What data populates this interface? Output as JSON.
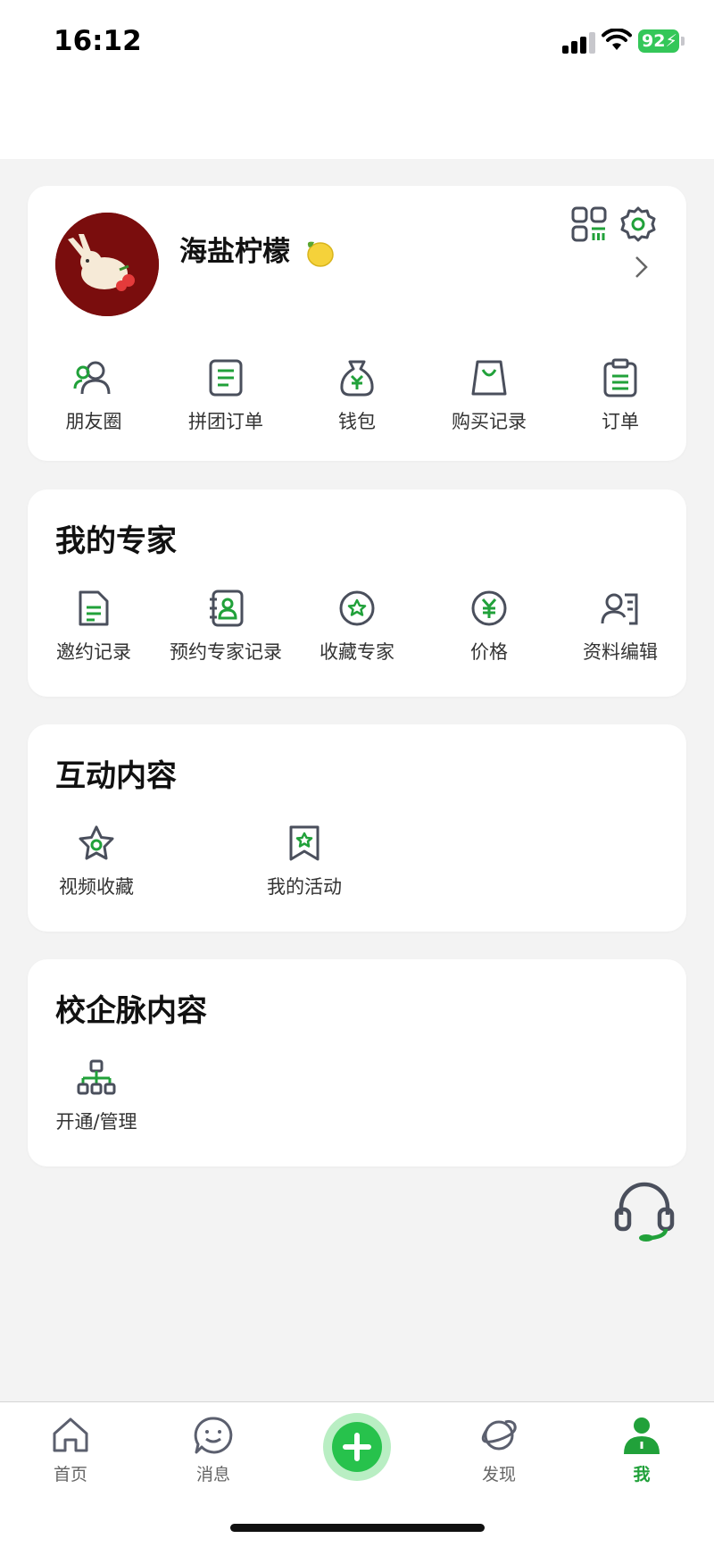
{
  "status_bar": {
    "time": "16:12",
    "battery": "92"
  },
  "profile": {
    "username": "海盐柠檬",
    "shortcuts": [
      "朋友圈",
      "拼团订单",
      "钱包",
      "购买记录",
      "订单"
    ]
  },
  "expert": {
    "title": "我的专家",
    "items": [
      "邀约记录",
      "预约专家记录",
      "收藏专家",
      "价格",
      "资料编辑"
    ]
  },
  "interaction": {
    "title": "互动内容",
    "items": [
      "视频收藏",
      "我的活动"
    ]
  },
  "school": {
    "title": "校企脉内容",
    "items": [
      "开通/管理"
    ]
  },
  "tabbar": {
    "tabs": [
      "首页",
      "消息",
      "发现",
      "我"
    ],
    "active": "我"
  },
  "colors": {
    "accent": "#21a13a",
    "icon": "#4a4f5c",
    "background": "#f3f3f3"
  }
}
